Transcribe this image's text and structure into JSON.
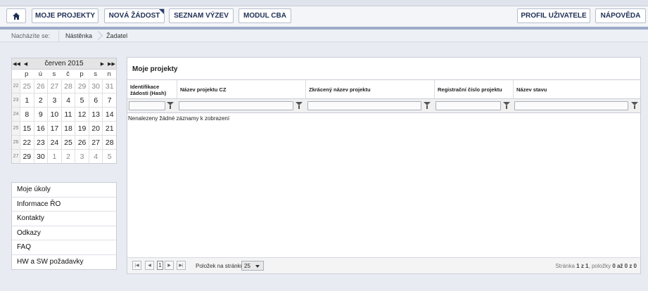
{
  "nav": {
    "home_icon": "home-icon",
    "left_buttons": [
      "MOJE PROJEKTY",
      "NOVÁ ŽÁDOST",
      "SEZNAM VÝZEV",
      "MODUL CBA"
    ],
    "right_buttons": [
      "PROFIL UŽIVATELE",
      "NÁPOVĚDA"
    ]
  },
  "breadcrumb": {
    "label": "Nacházíte se:",
    "items": [
      "Nástěnka",
      "Žadatel"
    ]
  },
  "calendar": {
    "title": "červen 2015",
    "nav": [
      "◀◀",
      "◀",
      "▶",
      "▶▶"
    ],
    "day_names": [
      "p",
      "ú",
      "s",
      "č",
      "p",
      "s",
      "n"
    ],
    "weeks": [
      {
        "week": "22",
        "days": [
          "25",
          "26",
          "27",
          "28",
          "29",
          "30",
          "31"
        ]
      },
      {
        "week": "23",
        "days": [
          "1",
          "2",
          "3",
          "4",
          "5",
          "6",
          "7"
        ]
      },
      {
        "week": "24",
        "days": [
          "8",
          "9",
          "10",
          "11",
          "12",
          "13",
          "14"
        ]
      },
      {
        "week": "25",
        "days": [
          "15",
          "16",
          "17",
          "18",
          "19",
          "20",
          "21"
        ]
      },
      {
        "week": "26",
        "days": [
          "22",
          "23",
          "24",
          "25",
          "26",
          "27",
          "28"
        ]
      },
      {
        "week": "27",
        "days": [
          "29",
          "30",
          "1",
          "2",
          "3",
          "4",
          "5"
        ]
      }
    ]
  },
  "side_menu": [
    "Moje úkoly",
    "Informace ŘO",
    "Kontakty",
    "Odkazy",
    "FAQ",
    "HW a SW požadavky"
  ],
  "grid": {
    "title": "Moje projekty",
    "columns": [
      "Identifikace žádosti (Hash)",
      "Název projektu CZ",
      "Zkrácený název projektu",
      "Registrační číslo projektu",
      "Název stavu"
    ],
    "empty_text": "Nenalezeny žádné záznamy k zobrazení",
    "pager": {
      "page": "1",
      "per_page_label": "Položek na stránku",
      "per_page_value": "25",
      "info_page_label": "Stránka",
      "info_page": "1 z 1",
      "info_items_label": ", položky",
      "info_items": "0 až 0 z 0"
    }
  }
}
